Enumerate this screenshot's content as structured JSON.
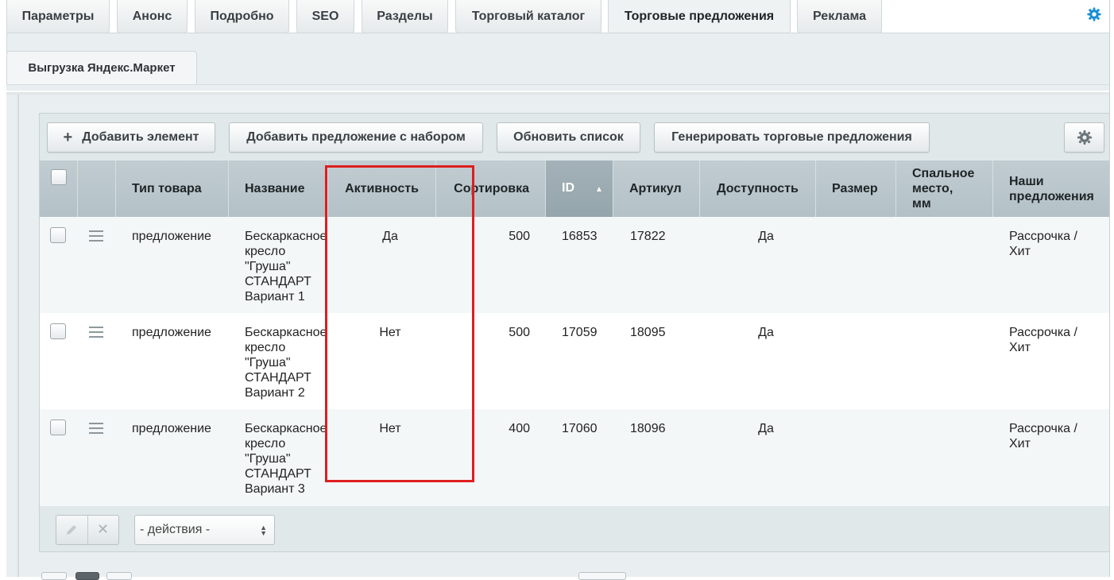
{
  "top_tabs": [
    "Параметры",
    "Анонс",
    "Подробно",
    "SEO",
    "Разделы",
    "Торговый каталог",
    "Торговые предложения",
    "Реклама"
  ],
  "active_tab": "Торговые предложения",
  "second_tab": "Выгрузка Яндекс.Маркет",
  "toolbar": {
    "add_element": "Добавить элемент",
    "add_offer_set": "Добавить предложение с набором",
    "refresh_list": "Обновить список",
    "generate_offers": "Генерировать торговые предложения"
  },
  "columns": {
    "type": "Тип товара",
    "name": "Название",
    "active": "Активность",
    "sort": "Сортировка",
    "id": "ID",
    "article": "Артикул",
    "availability": "Доступность",
    "size": "Размер",
    "sleep_l1": "Спальное",
    "sleep_l2": "место,",
    "sleep_l3": "мм",
    "our_l1": "Наши",
    "our_l2": "предложения"
  },
  "rows": [
    {
      "type": "предложение",
      "name": [
        "Бескаркасное",
        "кресло",
        "\"Груша\"",
        "СТАНДАРТ",
        "Вариант 1"
      ],
      "active": "Да",
      "sort": "500",
      "id": "16853",
      "article": "17822",
      "availability": "Да",
      "size": "",
      "sleep": "",
      "our": [
        "Рассрочка /",
        "Хит"
      ]
    },
    {
      "type": "предложение",
      "name": [
        "Бескаркасное",
        "кресло",
        "\"Груша\"",
        "СТАНДАРТ",
        "Вариант 2"
      ],
      "active": "Нет",
      "sort": "500",
      "id": "17059",
      "article": "18095",
      "availability": "Да",
      "size": "",
      "sleep": "",
      "our": [
        "Рассрочка /",
        "Хит"
      ]
    },
    {
      "type": "предложение",
      "name": [
        "Бескаркасное",
        "кресло",
        "\"Груша\"",
        "СТАНДАРТ",
        "Вариант 3"
      ],
      "active": "Нет",
      "sort": "400",
      "id": "17060",
      "article": "18096",
      "availability": "Да",
      "size": "",
      "sleep": "",
      "our": [
        "Рассрочка /",
        "Хит"
      ]
    }
  ],
  "footer": {
    "actions_select": "- действия -"
  },
  "colors": {
    "highlight": "#dd1e1e",
    "header_bg": "#b3c1c6",
    "sorted_header_bg": "#94a5ab",
    "toolbar_bg": "#e0e8ea",
    "settings_icon": "#1a8fd6"
  },
  "icons": [
    "settings-gear-icon",
    "plus-icon",
    "gear-icon",
    "drag-menu-icon",
    "sort-asc-icon",
    "pencil-icon",
    "delete-x-icon",
    "select-arrows-icon"
  ]
}
